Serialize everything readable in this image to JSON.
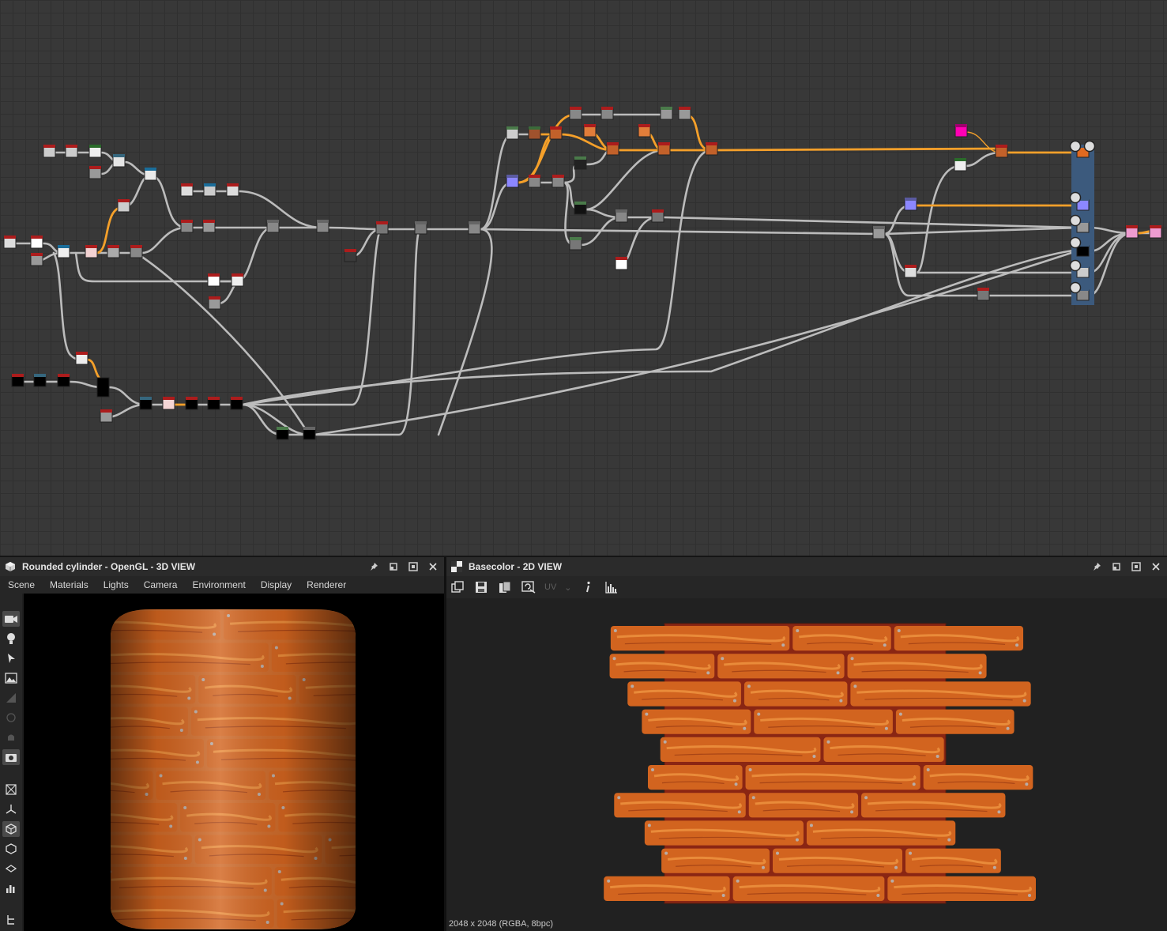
{
  "graph": {
    "background": "#383838",
    "wire_color": "#bcbcbc",
    "highlight_wire_color": "#f5a02a",
    "output_group_color": "#3c5a7d"
  },
  "panel3d": {
    "title": "Rounded cylinder - OpenGL - 3D VIEW",
    "icon": "cube-icon",
    "menu": [
      "Scene",
      "Materials",
      "Lights",
      "Camera",
      "Environment",
      "Display",
      "Renderer"
    ],
    "tools": [
      "camera-icon",
      "light-bulb-icon",
      "cursor-icon",
      "image-landscape-icon",
      "grid-icon",
      "sphere-icon",
      "bell-icon",
      "screenshot-icon",
      "cube-wire-icon",
      "axes-icon",
      "cube-solid-icon",
      "cube-outline-icon",
      "layers-icon",
      "bar-chart-icon",
      "hierarchy-icon"
    ]
  },
  "panel2d": {
    "title": "Basecolor - 2D VIEW",
    "icon": "checker-icon",
    "toolbar": [
      "copy-icon",
      "save-icon",
      "clipboard-icon",
      "refresh-icon"
    ],
    "uv_label": "UV",
    "tools_right": [
      "info-icon",
      "histogram-icon"
    ],
    "status": "2048 x 2048 (RGBA, 8bpc)"
  },
  "wood_colors": {
    "plank": "#d2641f",
    "plank_light": "#e98b3a",
    "groove": "#8a2613",
    "nail": "#b8aca6"
  }
}
